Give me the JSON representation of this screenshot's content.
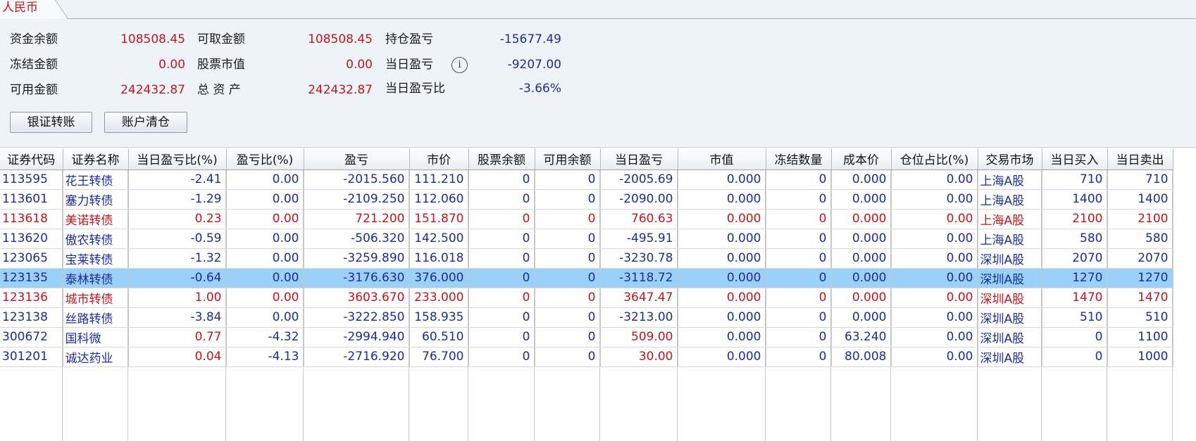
{
  "currency_tab": "人民币",
  "summary": {
    "balance_label": "资金余额",
    "balance": "108508.45",
    "withdrawable_label": "可取金额",
    "withdrawable": "108508.45",
    "position_pnl_label": "持仓盈亏",
    "position_pnl": "-15677.49",
    "frozen_label": "冻结金额",
    "frozen": "0.00",
    "stock_value_label": "股票市值",
    "stock_value": "0.00",
    "today_pnl_label": "当日盈亏",
    "today_pnl": "-9207.00",
    "available_label": "可用金额",
    "available": "242432.87",
    "total_assets_label": "总 资 产",
    "total_assets": "242432.87",
    "today_pnl_ratio_label": "当日盈亏比",
    "today_pnl_ratio": "-3.66%"
  },
  "buttons": {
    "bank_transfer": "银证转账",
    "clear_account": "账户清仓"
  },
  "icons": {
    "info": "info-icon"
  },
  "colors": {
    "gain": "#c0161c",
    "loss": "#1c2c9c",
    "selected_row": "#9bd0f8"
  },
  "table": {
    "columns": [
      "证券代码",
      "证券名称",
      "当日盈亏比(%)",
      "盈亏比(%)",
      "盈亏",
      "市价",
      "股票余额",
      "可用余额",
      "当日盈亏",
      "市值",
      "冻结数量",
      "成本价",
      "仓位占比(%)",
      "交易市场",
      "当日买入",
      "当日卖出"
    ],
    "selected_index": 5,
    "rows": [
      {
        "tone": "loss",
        "cells": [
          "113595",
          "花王转债",
          "-2.41",
          "0.00",
          "-2015.560",
          "111.210",
          "0",
          "0",
          "-2005.69",
          "0.000",
          "0",
          "0.000",
          "0.00",
          "上海A股",
          "710",
          "710"
        ]
      },
      {
        "tone": "loss",
        "cells": [
          "113601",
          "塞力转债",
          "-1.29",
          "0.00",
          "-2109.250",
          "112.060",
          "0",
          "0",
          "-2090.00",
          "0.000",
          "0",
          "0.000",
          "0.00",
          "上海A股",
          "1400",
          "1400"
        ]
      },
      {
        "tone": "gain",
        "cells": [
          "113618",
          "美诺转债",
          "0.23",
          "0.00",
          "721.200",
          "151.870",
          "0",
          "0",
          "760.63",
          "0.000",
          "0",
          "0.000",
          "0.00",
          "上海A股",
          "2100",
          "2100"
        ]
      },
      {
        "tone": "loss",
        "cells": [
          "113620",
          "傲农转债",
          "-0.59",
          "0.00",
          "-506.320",
          "142.500",
          "0",
          "0",
          "-495.91",
          "0.000",
          "0",
          "0.000",
          "0.00",
          "上海A股",
          "580",
          "580"
        ]
      },
      {
        "tone": "loss",
        "cells": [
          "123065",
          "宝莱转债",
          "-1.32",
          "0.00",
          "-3259.890",
          "116.018",
          "0",
          "0",
          "-3230.78",
          "0.000",
          "0",
          "0.000",
          "0.00",
          "深圳A股",
          "2070",
          "2070"
        ]
      },
      {
        "tone": "loss",
        "cells": [
          "123135",
          "泰林转债",
          "-0.64",
          "0.00",
          "-3176.630",
          "376.000",
          "0",
          "0",
          "-3118.72",
          "0.000",
          "0",
          "0.000",
          "0.00",
          "深圳A股",
          "1270",
          "1270"
        ]
      },
      {
        "tone": "gain",
        "cells": [
          "123136",
          "城市转债",
          "1.00",
          "0.00",
          "3603.670",
          "233.000",
          "0",
          "0",
          "3647.47",
          "0.000",
          "0",
          "0.000",
          "0.00",
          "深圳A股",
          "1470",
          "1470"
        ]
      },
      {
        "tone": "loss",
        "cells": [
          "123138",
          "丝路转债",
          "-3.84",
          "0.00",
          "-3222.850",
          "158.935",
          "0",
          "0",
          "-3213.00",
          "0.000",
          "0",
          "0.000",
          "0.00",
          "深圳A股",
          "510",
          "510"
        ]
      },
      {
        "tone": "mixed",
        "cells": [
          "300672",
          "国科微",
          "0.77",
          "-4.32",
          "-2994.940",
          "60.510",
          "0",
          "0",
          "509.00",
          "0.000",
          "0",
          "63.240",
          "0.00",
          "深圳A股",
          "0",
          "1100"
        ]
      },
      {
        "tone": "mixed",
        "cells": [
          "301201",
          "诚达药业",
          "0.04",
          "-4.13",
          "-2716.920",
          "76.700",
          "0",
          "0",
          "30.00",
          "0.000",
          "0",
          "80.008",
          "0.00",
          "深圳A股",
          "0",
          "1000"
        ]
      }
    ]
  }
}
